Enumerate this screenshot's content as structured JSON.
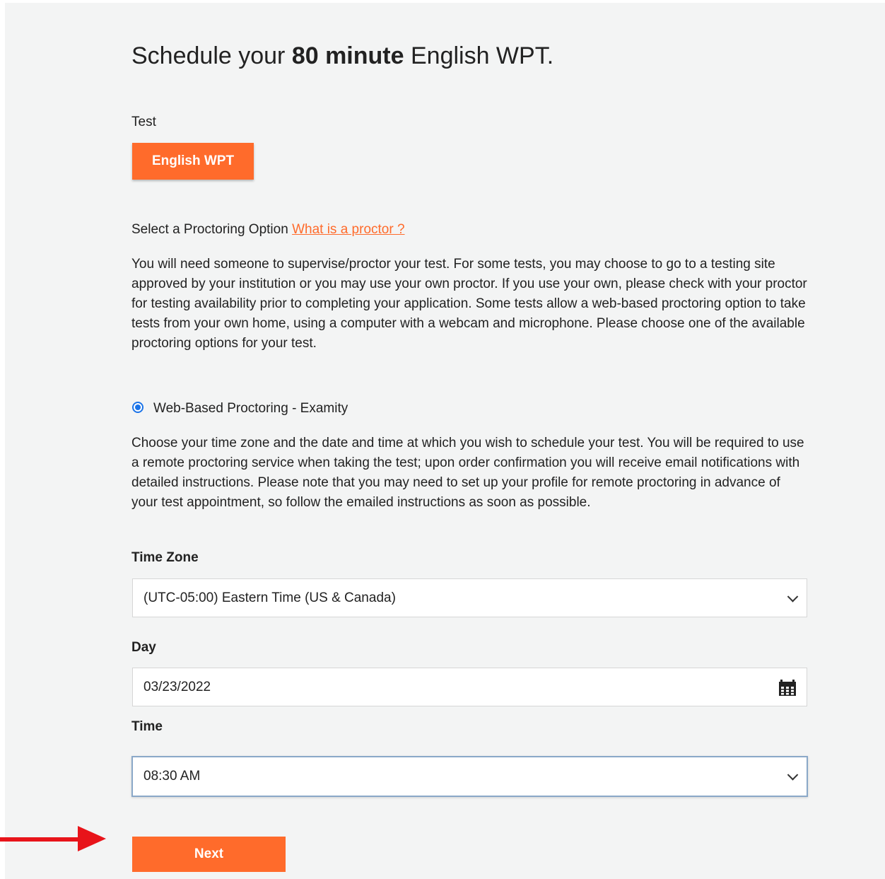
{
  "header": {
    "title_pre": "Schedule your ",
    "title_bold": "80 minute",
    "title_post": " English WPT."
  },
  "test_section": {
    "label": "Test",
    "selected_test": "English WPT"
  },
  "proctoring": {
    "label": "Select a Proctoring Option ",
    "link_text": "What is a proctor ?",
    "description": "You will need someone to supervise/proctor your test. For some tests, you may choose to go to a testing site approved by your institution or you may use your own proctor. If you use your own, please check with your proctor for testing availability prior to completing your application. Some tests allow a web-based proctoring option to take tests from your own home, using a computer with a webcam and microphone. Please choose one of the available proctoring options for your test.",
    "option_label": "Web-Based Proctoring - Examity",
    "option_selected": true,
    "instructions": "Choose your time zone and the date and time at which you wish to schedule your test. You will be required to use a remote proctoring service when taking the test; upon order confirmation you will receive email notifications with detailed instructions. Please note that you may need to set up your profile for remote proctoring in advance of your test appointment, so follow the emailed instructions as soon as possible."
  },
  "form": {
    "timezone_label": "Time Zone",
    "timezone_value": "(UTC-05:00) Eastern Time (US & Canada)",
    "day_label": "Day",
    "day_value": "03/23/2022",
    "time_label": "Time",
    "time_value": "08:30 AM",
    "next_label": "Next"
  },
  "colors": {
    "accent": "#ff6b2b",
    "arrow": "#e8141a",
    "radio": "#1a73e8",
    "panel": "#f3f4f4"
  },
  "icons": [
    "calendar-icon",
    "chevron-down-icon",
    "red-arrow-annotation"
  ]
}
